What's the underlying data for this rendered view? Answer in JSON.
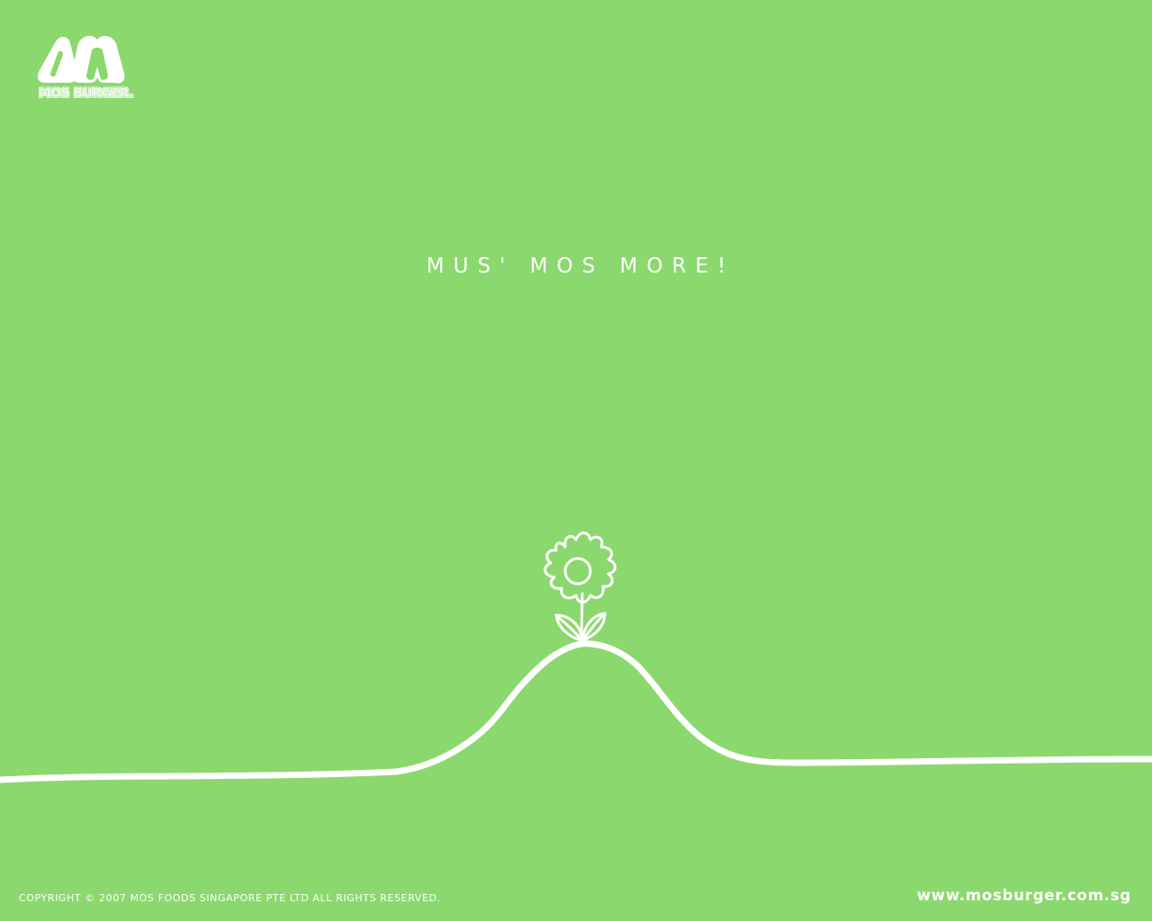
{
  "logo": {
    "brand_text": "MOS BURGER.",
    "icon": "mos-burger-m-logo"
  },
  "tagline": "MUS' MOS MORE!",
  "illustration": {
    "icon": "flower-on-hill-drawing"
  },
  "footer": {
    "copyright": "COPYRIGHT © 2007 MOS FOODS SINGAPORE PTE LTD ALL RIGHTS RESERVED.",
    "website": "www.mosburger.com.sg"
  },
  "colors": {
    "background": "#8bd86e",
    "foreground": "#ffffff"
  }
}
